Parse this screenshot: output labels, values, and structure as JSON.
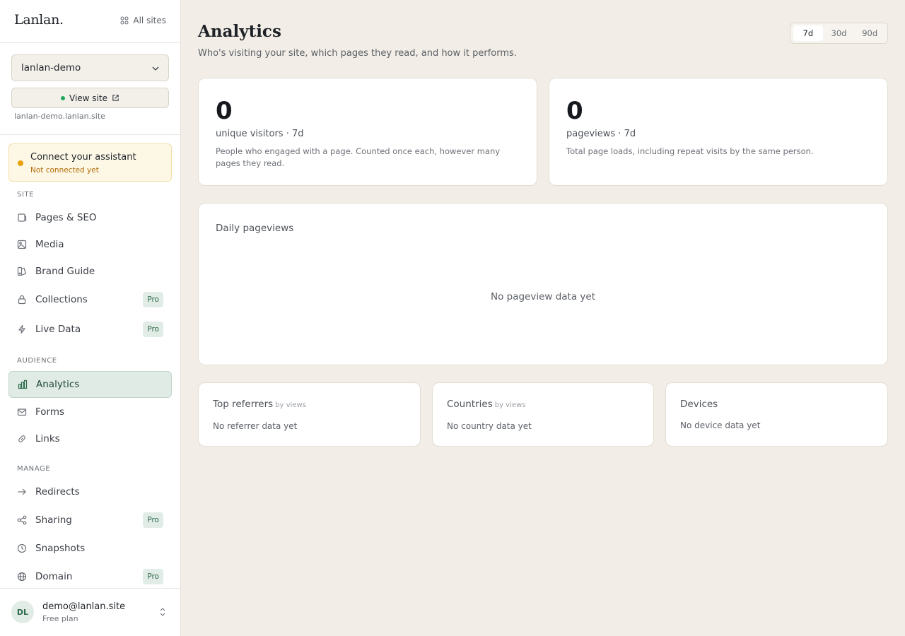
{
  "app": {
    "logo": "Lanlan.",
    "all_sites": "All sites"
  },
  "site": {
    "selected": "lanlan-demo",
    "view_site": "View site",
    "url": "lanlan-demo.lanlan.site"
  },
  "assistant": {
    "title": "Connect your assistant",
    "status": "Not connected yet"
  },
  "sidebar": {
    "sections": {
      "site": "SITE",
      "audience": "AUDIENCE",
      "manage": "MANAGE"
    },
    "items": [
      {
        "label": "Pages & SEO",
        "icon": "pages-icon",
        "pro": ""
      },
      {
        "label": "Media",
        "icon": "image-icon",
        "pro": ""
      },
      {
        "label": "Brand Guide",
        "icon": "palette-icon",
        "pro": ""
      },
      {
        "label": "Collections",
        "icon": "lock-icon",
        "pro": "Pro"
      },
      {
        "label": "Live Data",
        "icon": "lightning-icon",
        "pro": "Pro"
      },
      {
        "label": "Analytics",
        "icon": "bar-chart-icon",
        "pro": "",
        "active": true
      },
      {
        "label": "Forms",
        "icon": "mail-icon",
        "pro": ""
      },
      {
        "label": "Links",
        "icon": "link-icon",
        "pro": ""
      },
      {
        "label": "Redirects",
        "icon": "arrow-right-icon",
        "pro": ""
      },
      {
        "label": "Sharing",
        "icon": "share-icon",
        "pro": "Pro"
      },
      {
        "label": "Snapshots",
        "icon": "clock-icon",
        "pro": ""
      },
      {
        "label": "Domain",
        "icon": "globe-icon",
        "pro": "Pro"
      }
    ]
  },
  "user": {
    "initials": "DL",
    "email": "demo@lanlan.site",
    "plan": "Free plan"
  },
  "page": {
    "title": "Analytics",
    "subtitle": "Who's visiting your site, which pages they read, and how it performs.",
    "ranges": [
      "7d",
      "30d",
      "90d"
    ],
    "active_range": "7d"
  },
  "stats": [
    {
      "value": "0",
      "label": "unique visitors · 7d",
      "desc": "People who engaged with a page. Counted once each, however many pages they read."
    },
    {
      "value": "0",
      "label": "pageviews · 7d",
      "desc": "Total page loads, including repeat visits by the same person."
    }
  ],
  "daily": {
    "title": "Daily pageviews",
    "empty": "No pageview data yet"
  },
  "panels": [
    {
      "title": "Top referrers",
      "by": "by views",
      "empty": "No referrer data yet"
    },
    {
      "title": "Countries",
      "by": "by views",
      "empty": "No country data yet"
    },
    {
      "title": "Devices",
      "by": "",
      "empty": "No device data yet"
    }
  ],
  "colors": {
    "accent": "#2d6a4b",
    "active_bg": "#e0ebe5",
    "warning": "#e8a10a",
    "online": "#22a55a",
    "background": "#f2eee7"
  }
}
